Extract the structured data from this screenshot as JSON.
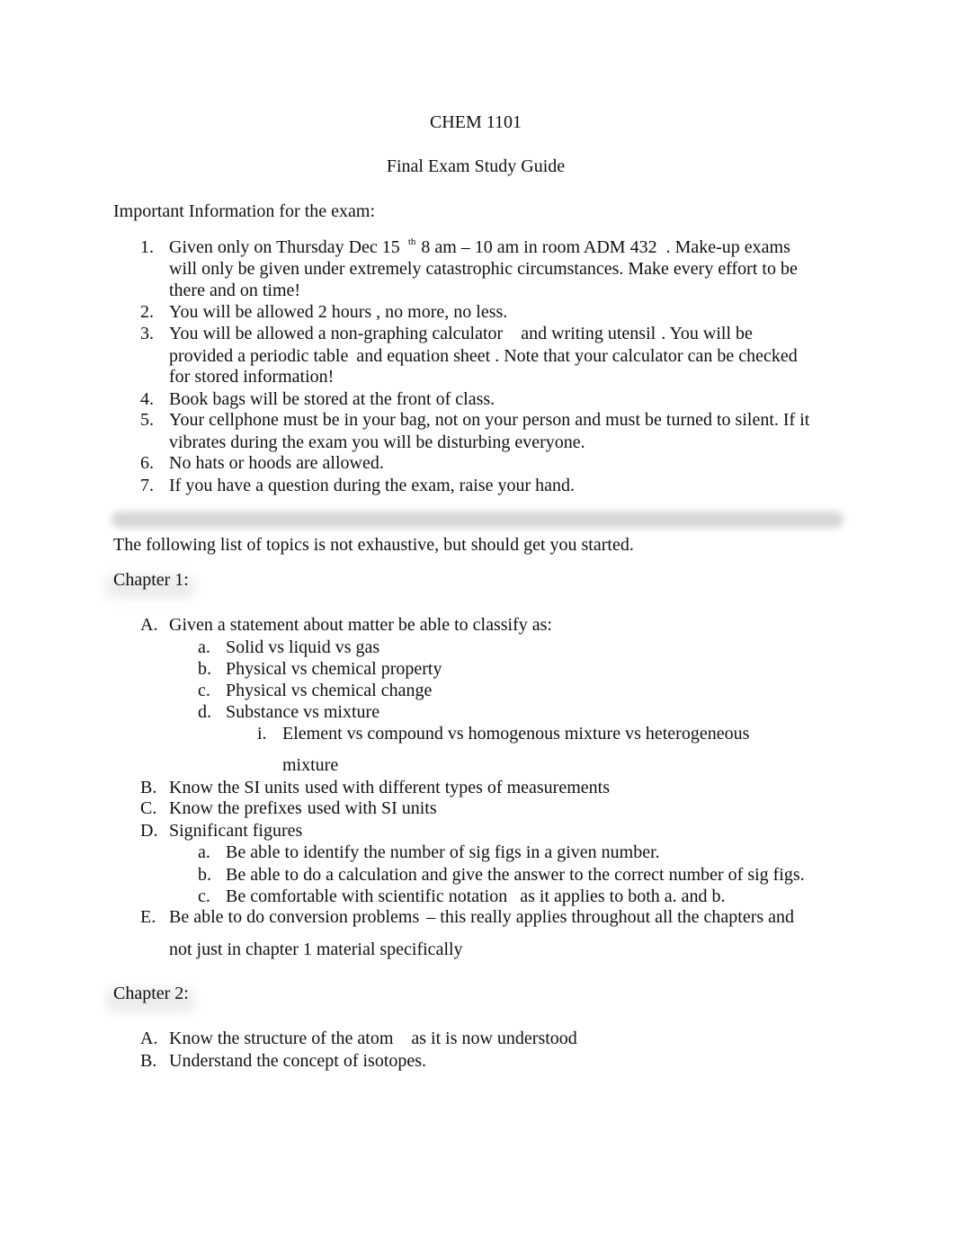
{
  "document": {
    "course": "CHEM 1101",
    "title": "Final Exam Study Guide",
    "intro_heading": "Important Information for the exam:",
    "info_items": [
      {
        "marker": "1.",
        "lines": [
          {
            "a": "Given only on Thursday Dec 15",
            "sup": "th",
            "b": "8 am – 10 am in room ADM 432",
            "c": ". Make-up exams"
          },
          "will only be given under extremely catastrophic circumstances.  Make every effort to be",
          "there and on time!"
        ]
      },
      {
        "marker": "2.",
        "lines": [
          "You will be allowed 2 hours , no more, no less."
        ]
      },
      {
        "marker": "3.",
        "lines": [
          {
            "a": "You will be allowed a  non-graphing calculator",
            "b": "and writing utensil",
            "c": ".  You will be"
          },
          {
            "a": "provided a periodic table",
            "b": "and equation sheet",
            "c": ".  Note that your calculator can be checked"
          },
          "for stored information!"
        ]
      },
      {
        "marker": "4.",
        "lines": [
          "Book bags  will be stored at the front of class."
        ]
      },
      {
        "marker": "5.",
        "lines": [
          "Your cellphone must be in your bag, not on your person and must be turned to silent. If it",
          "vibrates during the exam you will be disturbing everyone."
        ]
      },
      {
        "marker": "6.",
        "lines": [
          "No hats or hoods are allowed."
        ]
      },
      {
        "marker": "7.",
        "lines": [
          "If you have a question during the exam, raise your hand."
        ]
      }
    ],
    "topics_intro": "The following list of topics is not exhaustive, but should get you started.",
    "chapter1": {
      "heading": "Chapter 1:",
      "A": {
        "marker": "A.",
        "text": "Given a statement about matter be able to classify as:"
      },
      "A_sub": [
        {
          "marker": "a.",
          "text": "Solid vs liquid vs gas"
        },
        {
          "marker": "b.",
          "text": "Physical vs chemical property"
        },
        {
          "marker": "c.",
          "text": "Physical vs chemical change"
        },
        {
          "marker": "d.",
          "text": "Substance vs mixture"
        }
      ],
      "A_d_i": {
        "marker": "i.",
        "line1": "Element vs compound vs homogenous mixture vs heterogeneous",
        "line2": "mixture"
      },
      "B": {
        "marker": "B.",
        "a": "Know the SI units",
        "b": "used with different types of measurements"
      },
      "C": {
        "marker": "C.",
        "a": "Know the prefixes",
        "b": "used with SI units"
      },
      "D": {
        "marker": "D.",
        "text": "Significant figures"
      },
      "D_sub": [
        {
          "marker": "a.",
          "text": "Be able to identify the number of sig figs in a given number."
        },
        {
          "marker": "b.",
          "text": "Be able to do a calculation and give the answer to the correct number of sig figs."
        },
        {
          "marker": "c.",
          "a": "Be comfortable with scientific notation",
          "b": "as it applies to both a. and b."
        }
      ],
      "E": {
        "marker": "E.",
        "a": "Be able to do conversion problems",
        "b": "– this really applies throughout all the chapters and",
        "line2": "not just in chapter 1 material specifically"
      }
    },
    "chapter2": {
      "heading": "Chapter 2:",
      "items": [
        {
          "marker": "A.",
          "a": "Know the structure of the atom",
          "b": "as it is now understood"
        },
        {
          "marker": "B.",
          "a": "Understand the concept of isotopes",
          "b": "."
        }
      ]
    }
  }
}
